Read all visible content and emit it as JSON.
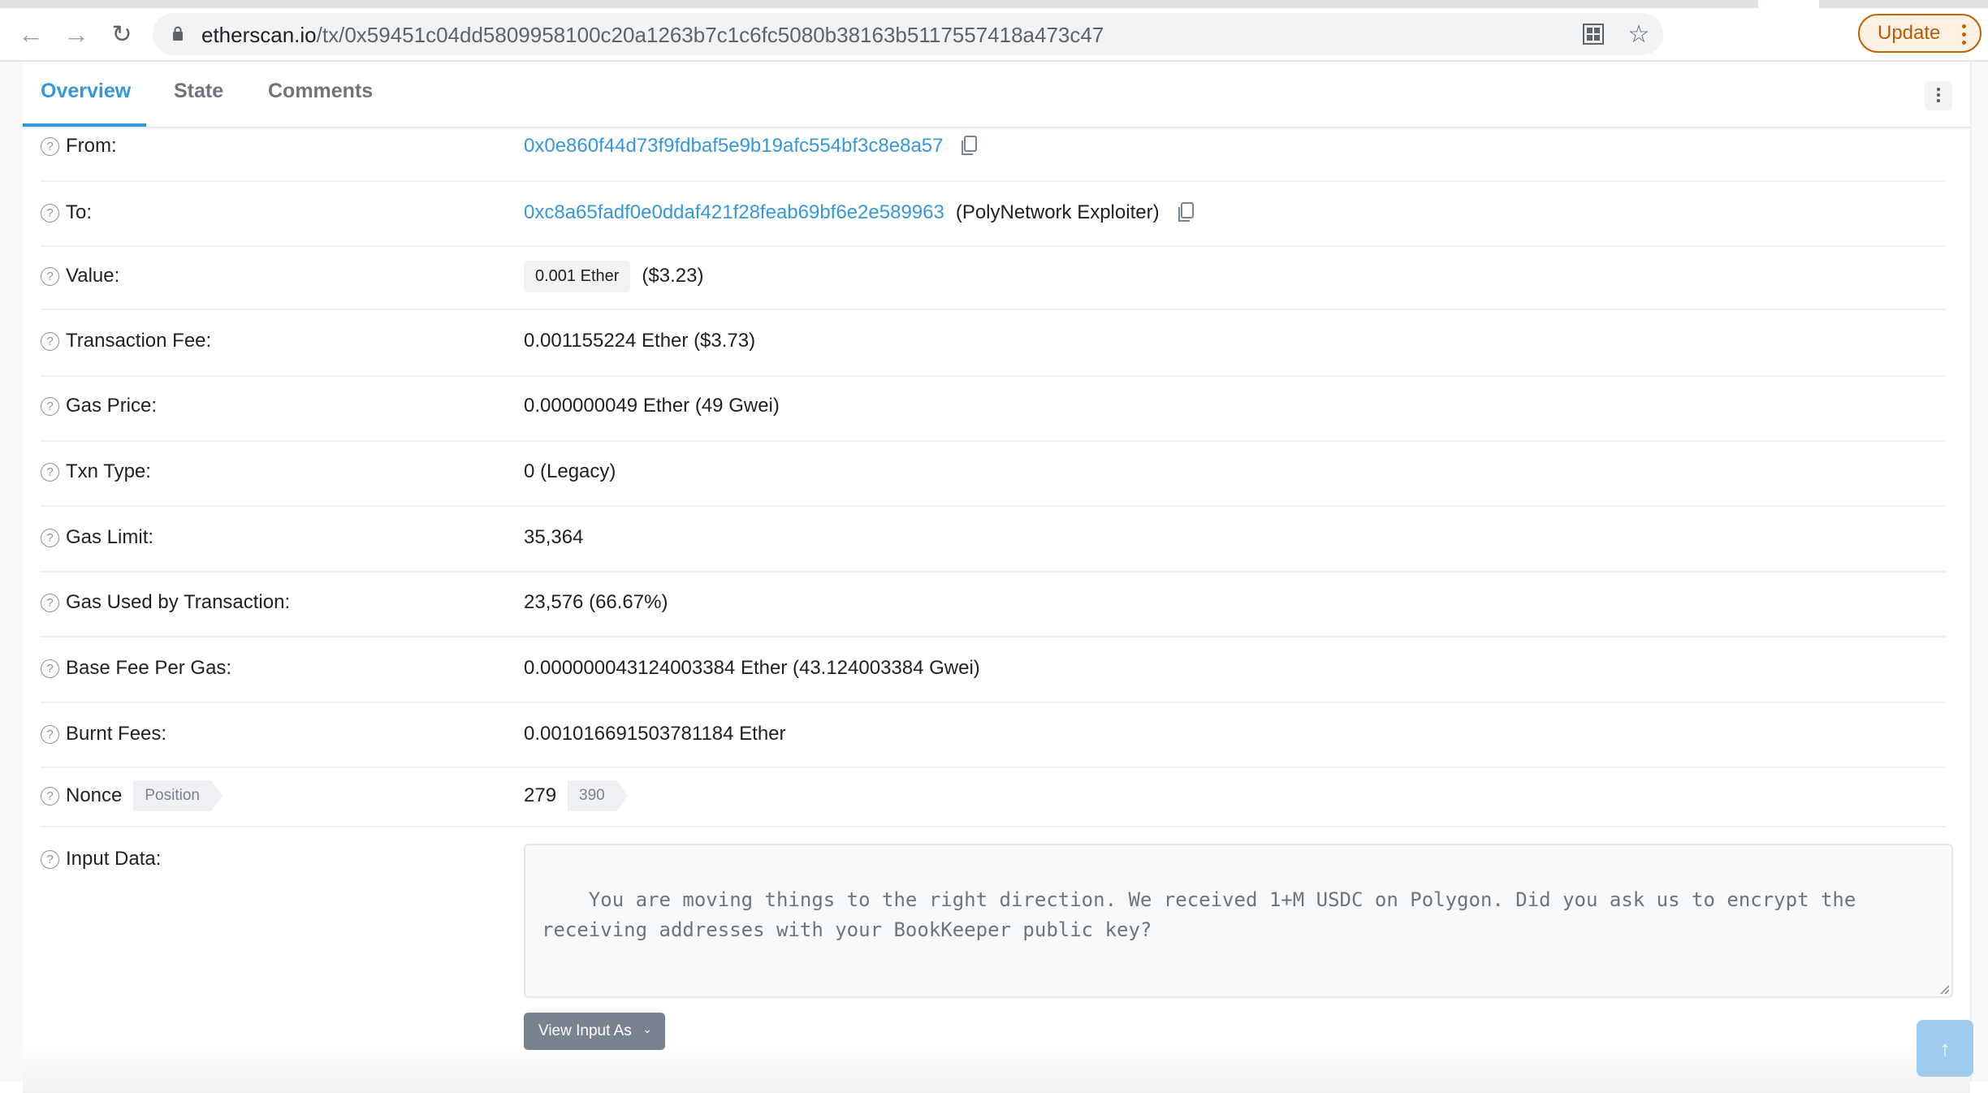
{
  "browser": {
    "url_domain": "etherscan.io",
    "url_path": "/tx/0x59451c04dd5809958100c20a1263b7c1c6fc5080b38163b5117557418a473c47",
    "update_label": "Update",
    "icons": [
      "back-icon",
      "forward-icon",
      "reload-icon",
      "lock-icon",
      "qr-code-icon",
      "bookmark-star-icon",
      "kebab-menu-icon"
    ]
  },
  "tabs": [
    {
      "label": "Overview",
      "active": true
    },
    {
      "label": "State",
      "active": false
    },
    {
      "label": "Comments",
      "active": false
    }
  ],
  "rows": {
    "from": {
      "label": "From:",
      "address": "0x0e860f44d73f9fdbaf5e9b19afc554bf3c8e8a57"
    },
    "to": {
      "label": "To:",
      "address": "0xc8a65fadf0e0ddaf421f28feab69bf6e2e589963",
      "name_tag": "(PolyNetwork Exploiter)"
    },
    "value": {
      "label": "Value:",
      "amount": "0.001 Ether",
      "usd": "($3.23)"
    },
    "fee": {
      "label": "Transaction Fee:",
      "value": "0.001155224 Ether ($3.73)"
    },
    "gas_price": {
      "label": "Gas Price:",
      "value": "0.000000049 Ether (49 Gwei)"
    },
    "txn_type": {
      "label": "Txn Type:",
      "value": "0 (Legacy)"
    },
    "gas_limit": {
      "label": "Gas Limit:",
      "value": "35,364"
    },
    "gas_used": {
      "label": "Gas Used by Transaction:",
      "value": "23,576 (66.67%)"
    },
    "base_fee": {
      "label": "Base Fee Per Gas:",
      "value": "0.000000043124003384 Ether (43.124003384 Gwei)"
    },
    "burnt": {
      "label": "Burnt Fees:",
      "value": "0.001016691503781184 Ether"
    },
    "nonce": {
      "label": "Nonce",
      "position_tag": "Position",
      "value": "279",
      "position": "390"
    },
    "input": {
      "label": "Input Data:",
      "text": "You are moving things to the right direction. We received 1+M USDC on Polygon. Did you ask us to encrypt the receiving addresses with your BookKeeper public key?",
      "view_as_label": "View Input As"
    }
  },
  "colors": {
    "accent": "#3498db",
    "update": "#c26401",
    "button_gray": "#77838f"
  }
}
